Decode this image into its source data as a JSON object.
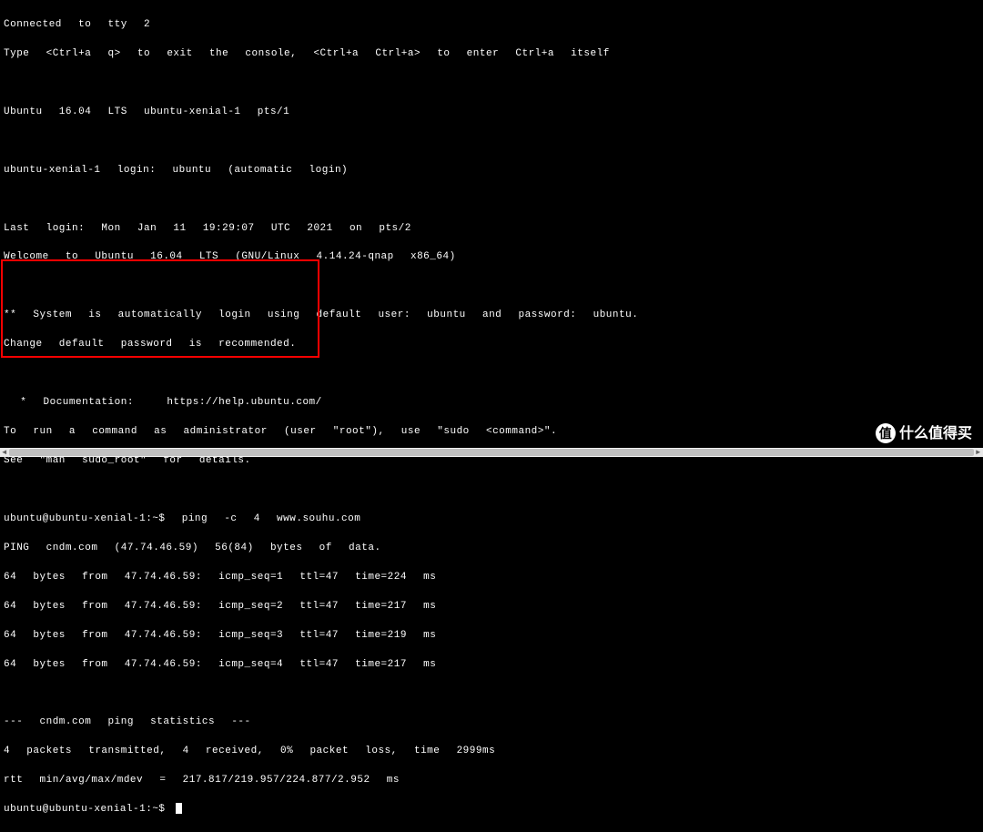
{
  "terminal": {
    "lines": {
      "l1": "Connected  to  tty  2",
      "l2": "Type  <Ctrl+a  q>  to  exit  the  console,  <Ctrl+a  Ctrl+a>  to  enter  Ctrl+a  itself",
      "l3": "",
      "l4": "Ubuntu  16.04  LTS  ubuntu-xenial-1  pts/1",
      "l5": "",
      "l6": "ubuntu-xenial-1  login:  ubuntu  (automatic  login)",
      "l7": "",
      "l8": "Last  login:  Mon  Jan  11  19:29:07  UTC  2021  on  pts/2",
      "l9": "Welcome  to  Ubuntu  16.04  LTS  (GNU/Linux  4.14.24-qnap  x86_64)",
      "l10": "",
      "l11": "**  System  is  automatically  login  using  default  user:  ubuntu  and  password:  ubuntu.",
      "l12": "Change  default  password  is  recommended.",
      "l13": "",
      "l14": "  *  Documentation:    https://help.ubuntu.com/",
      "l15": "To  run  a  command  as  administrator  (user  \"root\"),  use  \"sudo  <command>\".",
      "l16": "See  \"man  sudo_root\"  for  details.",
      "l17": "",
      "l18": "ubuntu@ubuntu-xenial-1:~$  ping  -c  4  www.souhu.com",
      "l19": "PING  cndm.com  (47.74.46.59)  56(84)  bytes  of  data.",
      "l20": "64  bytes  from  47.74.46.59:  icmp_seq=1  ttl=47  time=224  ms",
      "l21": "64  bytes  from  47.74.46.59:  icmp_seq=2  ttl=47  time=217  ms",
      "l22": "64  bytes  from  47.74.46.59:  icmp_seq=3  ttl=47  time=219  ms",
      "l23": "64  bytes  from  47.74.46.59:  icmp_seq=4  ttl=47  time=217  ms",
      "l24": "",
      "l25": "---  cndm.com  ping  statistics  ---",
      "l26": "4  packets  transmitted,  4  received,  0%  packet  loss,  time  2999ms",
      "l27": "rtt  min/avg/max/mdev  =  217.817/219.957/224.877/2.952  ms",
      "l28": "ubuntu@ubuntu-xenial-1:~$ "
    }
  },
  "watermark": {
    "icon_text": "值",
    "text": "什么值得买"
  }
}
